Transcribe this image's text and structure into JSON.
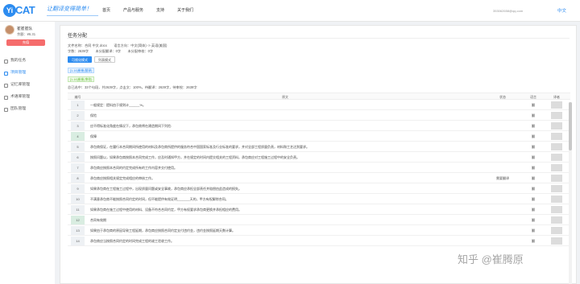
{
  "brand": {
    "logo_badge": "Yi",
    "logo_text": "CAT",
    "slogan": "让翻译变得简单！"
  },
  "nav": {
    "items": [
      "首页",
      "产品与服务",
      "支持",
      "关于我们"
    ]
  },
  "header": {
    "email": "353062658@qq.com",
    "language": "中文"
  },
  "sidebar": {
    "user_name": "崔崔崔队",
    "balance": "余额：¥6.31",
    "charge_label": "充值",
    "items": [
      {
        "label": "我的任务",
        "active": false,
        "icon": "task-icon"
      },
      {
        "label": "项目管理",
        "active": true,
        "icon": "project-icon"
      },
      {
        "label": "记忆库管理",
        "active": false,
        "icon": "memory-icon"
      },
      {
        "label": "术语库管理",
        "active": false,
        "icon": "term-icon"
      },
      {
        "label": "团队管理",
        "active": false,
        "icon": "team-icon"
      }
    ]
  },
  "main": {
    "title": "任务分配",
    "info_line1": "文件名称：合同 中文.docx　　语言方向：中文(简体) -> 英语(美国)",
    "info_line2": "字数：2639字　　未分配翻译：0字　　未分配审校：0字",
    "modes": [
      {
        "label": "可视化模式",
        "active": true
      },
      {
        "label": "列表模式",
        "active": false
      }
    ],
    "tag_source": "[1-16]崔崔(翻译)",
    "tag_reviewer": "[1-16]崔崔(审校)",
    "stats": "总已选中：33个句段，共2639字，点击文：100%，待翻译：2639字，待审校：2639字",
    "table": {
      "headers": {
        "num": "编号",
        "original": "原文",
        "status": "状态",
        "lang": "语言",
        "user": "译者"
      },
      "rows": [
        {
          "num": "1",
          "text": "一般规定：提料由于规则计______%。",
          "status": "",
          "lang": "翻",
          "done": false
        },
        {
          "num": "2",
          "text": "保险",
          "status": "",
          "lang": "翻",
          "done": false
        },
        {
          "num": "3",
          "text": "应不得标准化角度在情况下，承包商将在建造期间下列险:",
          "status": "",
          "lang": "翻",
          "done": false
        },
        {
          "num": "4",
          "text": "保障",
          "status": "",
          "lang": "翻",
          "done": true
        },
        {
          "num": "5",
          "text": "承包商保证，在履行本合同期间所使用的材料及承包商所提供的服务符合中国国家标准及行业标准的要求，并对全部工程质量负责，材料和工艺达到要求。",
          "status": "",
          "lang": "翻",
          "done": false
        },
        {
          "num": "6",
          "text": "按照问题以，如果承包商按照本合同完成工作，应及时通知甲方，并在规定的时间内提交相关的工程资料，承包商应对工程施工过程中的安全负责。",
          "status": "",
          "lang": "翻",
          "done": false
        },
        {
          "num": "7",
          "text": "承包商应按照本合同的约定完成所有的工作内容并交付使用。",
          "status": "",
          "lang": "翻",
          "done": false
        },
        {
          "num": "8",
          "text": "承包商应按照相关规定完成相应的审核工作。",
          "status": "需要翻译",
          "lang": "翻",
          "done": false
        },
        {
          "num": "9",
          "text": "如果承包商在工程施工过程中，出现质量问题或安全事故，承包商应承担全部责任并赔偿由此造成的损失。",
          "status": "",
          "lang": "翻",
          "done": false
        },
        {
          "num": "10",
          "text": "不满意承包商不能按照合同约定的时间，但不能提供有效证明_______天的，甲方有权解除合同。",
          "status": "",
          "lang": "翻",
          "done": false
        },
        {
          "num": "11",
          "text": "如果承包商在施工过程中使用的材料、设备不符合合同约定，甲方有权要求承包商更换并承担相应的费用。",
          "status": "",
          "lang": "翻",
          "done": false
        },
        {
          "num": "12",
          "text": "合同有效期",
          "status": "",
          "lang": "翻",
          "done": true
        },
        {
          "num": "13",
          "text": "如果由于承包商的原因导致工程延期，承包商应按照合同约定支付违约金，违约金按照延期天数计算。",
          "status": "",
          "lang": "翻",
          "done": false
        },
        {
          "num": "14",
          "text": "承包商应当按照合同约定的时间完成工程的竣工验收工作。",
          "status": "",
          "lang": "翻",
          "done": false
        }
      ]
    }
  },
  "watermark": "知乎 @崔腾原"
}
